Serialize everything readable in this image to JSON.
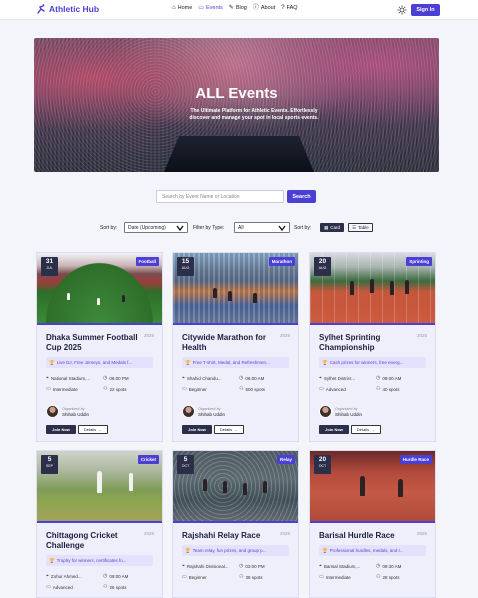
{
  "nav": {
    "brand": "Athletic Hub",
    "links": [
      {
        "label": "Home",
        "icon": "home-icon"
      },
      {
        "label": "Events",
        "icon": "calendar-icon"
      },
      {
        "label": "Blog",
        "icon": "blog-icon"
      },
      {
        "label": "About",
        "icon": "info-icon"
      },
      {
        "label": "FAQ",
        "icon": "question-icon"
      }
    ],
    "active": "Events",
    "sign_in": "Sign In"
  },
  "hero": {
    "title": "ALL Events",
    "subtitle": "The Ultimate Platform for Athletic Events. Effortlessly discover and manage your spot in local sports events."
  },
  "search": {
    "placeholder": "Search by Event Name or Location",
    "button": "Search"
  },
  "filters": {
    "sort_label": "Sort by:",
    "sort_value": "Date (Upcoming)",
    "type_label": "Filter by Type:",
    "type_value": "All",
    "view_label": "Sort by:",
    "view_grid": "Card",
    "view_table": "Table"
  },
  "colors": {
    "accent": "#4b3fd6",
    "dark": "#2b2f4a",
    "card_bg": "#efeffc"
  },
  "cards": [
    {
      "day": "31",
      "month": "JUL",
      "category": "Football",
      "title": "Dhaka Summer Football Cup 2025",
      "year": "2025",
      "prize": "Live DJ, Free Jerseys, and Medals f...",
      "location": "National Stadium,...",
      "time": "06:00 PM",
      "level": "Intermediate",
      "spots": "22 spots",
      "organizer_label": "Organized by",
      "organizer": "Shihab Uddin",
      "join": "Join Now",
      "details": "Details"
    },
    {
      "day": "15",
      "month": "AUG",
      "category": "Marathon",
      "title": "Citywide Marathon for Health",
      "year": "2025",
      "prize": "Free T-shirt, Medal, and Refreshmen...",
      "location": "Shahid Chandu...",
      "time": "06:00 AM",
      "level": "Beginner",
      "spots": "500 spots",
      "organizer_label": "Organized by",
      "organizer": "Shihab Uddin",
      "join": "Join Now",
      "details": "Details"
    },
    {
      "day": "20",
      "month": "AUG",
      "category": "Sprinting",
      "title": "Sylhet Sprinting Championship",
      "year": "2025",
      "prize": "Cash prizes for winners, free energ...",
      "location": "Sylhet District...",
      "time": "09:00 AM",
      "level": "Advanced",
      "spots": "40 spots",
      "organizer_label": "Organized by",
      "organizer": "Shihab Uddin",
      "join": "Join Now",
      "details": "Details"
    },
    {
      "day": "5",
      "month": "SEP",
      "category": "Cricket",
      "title": "Chittagong Cricket Challenge",
      "year": "2025",
      "prize": "Trophy for winners, certificates fo...",
      "location": "Zohur Ahmed...",
      "time": "09:00 AM",
      "level": "Advanced",
      "spots": "26 spots"
    },
    {
      "day": "5",
      "month": "OCT",
      "category": "Relay",
      "title": "Rajshahi Relay Race",
      "year": "2025",
      "prize": "Team relay, fun prizes, and group p...",
      "location": "Rajshahi Divisional...",
      "time": "03:00 PM",
      "level": "Beginner",
      "spots": "38 spots"
    },
    {
      "day": "20",
      "month": "OCT",
      "category": "Hurdle Race",
      "title": "Barisal Hurdle Race",
      "year": "2025",
      "prize": "Professional hurdles, medals, and r...",
      "location": "Barisal Stadium,...",
      "time": "09:30 AM",
      "level": "Intermediate",
      "spots": "28 spots"
    }
  ]
}
